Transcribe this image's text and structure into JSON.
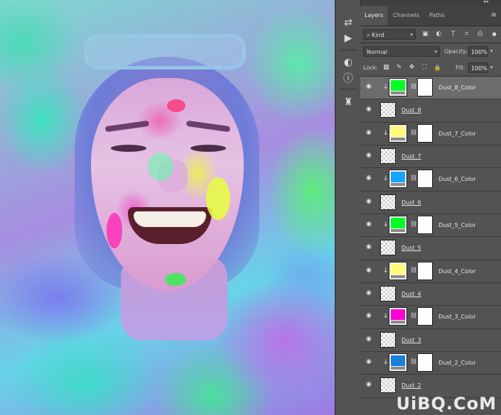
{
  "canvas": {
    "description_icon": "photo-canvas"
  },
  "tools": [
    {
      "name": "history-icon",
      "glyph": "⇄"
    },
    {
      "name": "play-action-icon",
      "glyph": "▶"
    },
    {
      "name": "adjustments-icon",
      "glyph": "◐"
    },
    {
      "name": "info-icon",
      "glyph": "ⓘ"
    },
    {
      "name": "stamp-icon",
      "glyph": "♜"
    }
  ],
  "panel": {
    "tabs": [
      "Layers",
      "Channels",
      "Paths"
    ],
    "active_tab": "Layers",
    "menu_glyph": "≡",
    "filter": {
      "label": "Kind",
      "search_glyph": "⌕",
      "chevron": "▾"
    },
    "filter_icons": [
      "▣",
      "◐",
      "T",
      "⌗",
      "⎙"
    ],
    "blend_mode": "Normal",
    "opacity_label": "Opacity:",
    "opacity_value": "100%",
    "lock_label": "Lock:",
    "lock_icons": [
      "▦",
      "✎",
      "✥",
      "⛶",
      "🔒"
    ],
    "fill_label": "Fill:",
    "fill_value": "100%"
  },
  "layers": [
    {
      "name": "Dust_8_Color",
      "type": "adjustment",
      "color": "#00ff22",
      "selected": true
    },
    {
      "name": "Dust_8",
      "type": "pixel"
    },
    {
      "name": "Dust_7_Color",
      "type": "adjustment",
      "color": "#fff97a"
    },
    {
      "name": "Dust_7",
      "type": "pixel"
    },
    {
      "name": "Dust_6_Color",
      "type": "adjustment",
      "color": "#1aa3ff"
    },
    {
      "name": "Dust_6",
      "type": "pixel"
    },
    {
      "name": "Dust_5_Color",
      "type": "adjustment",
      "color": "#00ff22"
    },
    {
      "name": "Dust_5",
      "type": "pixel"
    },
    {
      "name": "Dust_4_Color",
      "type": "adjustment",
      "color": "#fff97a"
    },
    {
      "name": "Dust_4",
      "type": "pixel"
    },
    {
      "name": "Dust_3_Color",
      "type": "adjustment",
      "color": "#ff00d6"
    },
    {
      "name": "Dust_3",
      "type": "pixel"
    },
    {
      "name": "Dust_2_Color",
      "type": "adjustment",
      "color": "#1b7fd8"
    },
    {
      "name": "Dust_2",
      "type": "pixel"
    }
  ],
  "watermark": "UiBQ.CoM"
}
